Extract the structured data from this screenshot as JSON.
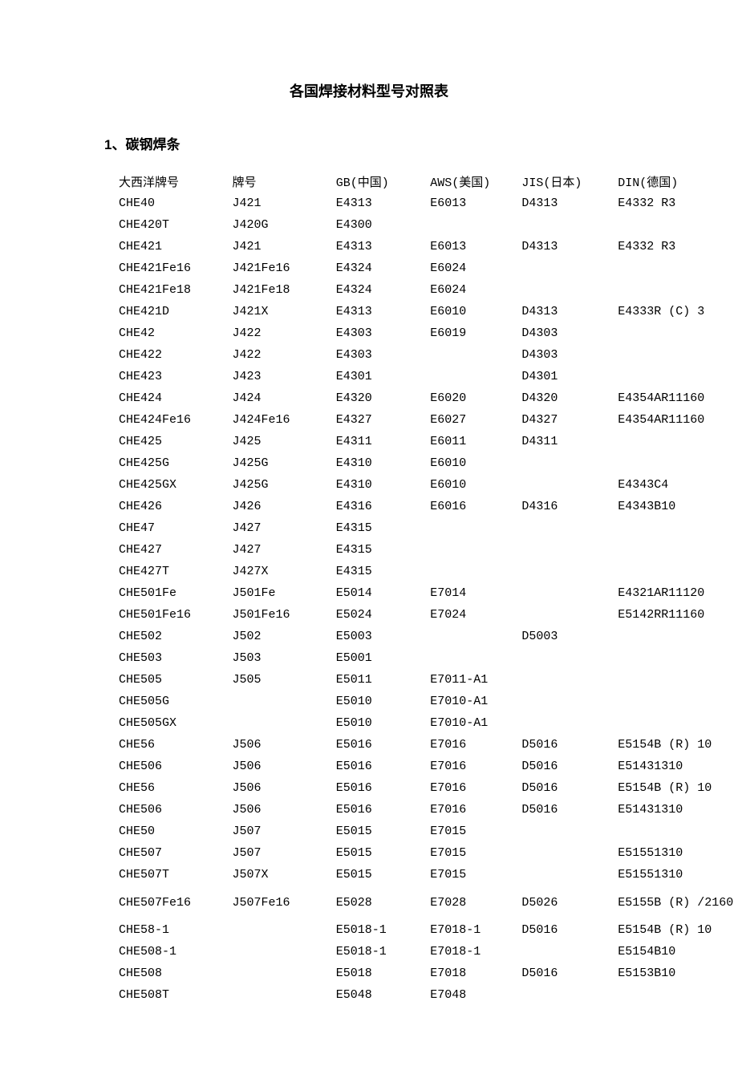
{
  "title": "各国焊接材料型号对照表",
  "section1": {
    "heading": "1、碳钢焊条"
  },
  "headers": [
    "大西洋牌号",
    "牌号",
    "GB(中国)",
    "AWS(美国)",
    "JIS(日本)",
    "DIN(德国)"
  ],
  "rows": [
    [
      "CHE40",
      "J421",
      "E4313",
      "E6013",
      "D4313",
      "E4332 R3"
    ],
    [
      "CHE420T",
      "J420G",
      "E4300",
      "",
      "",
      ""
    ],
    [
      "CHE421",
      "J421",
      "E4313",
      "E6013",
      "D4313",
      "E4332 R3"
    ],
    [
      "CHE421Fe16",
      "J421Fe16",
      "E4324",
      "E6024",
      "",
      ""
    ],
    [
      "CHE421Fe18",
      "J421Fe18",
      "E4324",
      "E6024",
      "",
      ""
    ],
    [
      "CHE421D",
      "J421X",
      "E4313",
      "E6010",
      "D4313",
      "E4333R (C) 3"
    ],
    [
      "CHE42",
      "J422",
      "E4303",
      "E6019",
      "D4303",
      ""
    ],
    [
      "CHE422",
      "J422",
      "E4303",
      "",
      "D4303",
      ""
    ],
    [
      "CHE423",
      "J423",
      "E4301",
      "",
      "D4301",
      ""
    ],
    [
      "CHE424",
      "J424",
      "E4320",
      "E6020",
      "D4320",
      "E4354AR11160"
    ],
    [
      "CHE424Fe16",
      "J424Fe16",
      "E4327",
      "E6027",
      "D4327",
      "E4354AR11160"
    ],
    [
      "CHE425",
      "J425",
      "E4311",
      "E6011",
      "D4311",
      ""
    ],
    [
      "CHE425G",
      "J425G",
      "E4310",
      "E6010",
      "",
      ""
    ],
    [
      "CHE425GX",
      "J425G",
      "E4310",
      "E6010",
      "",
      "E4343C4"
    ],
    [
      "CHE426",
      "J426",
      "E4316",
      "E6016",
      "D4316",
      "E4343B10"
    ],
    [
      "CHE47",
      "J427",
      "E4315",
      "",
      "",
      ""
    ],
    [
      "CHE427",
      "J427",
      "E4315",
      "",
      "",
      ""
    ],
    [
      "CHE427T",
      "J427X",
      "E4315",
      "",
      "",
      ""
    ],
    [
      "CHE501Fe",
      "J501Fe",
      "E5014",
      "E7014",
      "",
      "E4321AR11120"
    ],
    [
      "CHE501Fe16",
      "J501Fe16",
      "E5024",
      "E7024",
      "",
      "E5142RR11160"
    ],
    [
      "CHE502",
      "J502",
      "E5003",
      "",
      "D5003",
      ""
    ],
    [
      "CHE503",
      "J503",
      "E5001",
      "",
      "",
      ""
    ],
    [
      "CHE505",
      "J505",
      "E5011",
      "E7011-A1",
      "",
      ""
    ],
    [
      "CHE505G",
      "",
      "E5010",
      "E7010-A1",
      "",
      ""
    ],
    [
      "CHE505GX",
      "",
      "E5010",
      "E7010-A1",
      "",
      ""
    ],
    [
      "CHE56",
      "J506",
      "E5016",
      "E7016",
      "D5016",
      "E5154B (R) 10"
    ],
    [
      "CHE506",
      "J506",
      "E5016",
      "E7016",
      "D5016",
      "E51431310"
    ],
    [
      "CHE56",
      "J506",
      "E5016",
      "E7016",
      "D5016",
      "E5154B (R) 10"
    ],
    [
      "CHE506",
      "J506",
      "E5016",
      "E7016",
      "D5016",
      "E51431310"
    ],
    [
      "CHE50",
      "J507",
      "E5015",
      "E7015",
      "",
      ""
    ],
    [
      "CHE507",
      "J507",
      "E5015",
      "E7015",
      "",
      "E51551310"
    ],
    [
      "CHE507T",
      "J507X",
      "E5015",
      "E7015",
      "",
      "E51551310"
    ],
    [
      "CHE507Fe16",
      "J507Fe16",
      "E5028",
      "E7028",
      "D5026",
      "E5155B (R) /2160"
    ],
    [
      "CHE58-1",
      "",
      "E5018-1",
      "E7018-1",
      "D5016",
      "E5154B (R) 10"
    ],
    [
      "CHE508-1",
      "",
      "E5018-1",
      "E7018-1",
      "",
      "E5154B10"
    ],
    [
      "CHE508",
      "",
      "E5018",
      "E7018",
      "D5016",
      "E5153B10"
    ],
    [
      "CHE508T",
      "",
      "E5048",
      "E7048",
      "",
      ""
    ]
  ],
  "tall_rows": [
    32
  ]
}
